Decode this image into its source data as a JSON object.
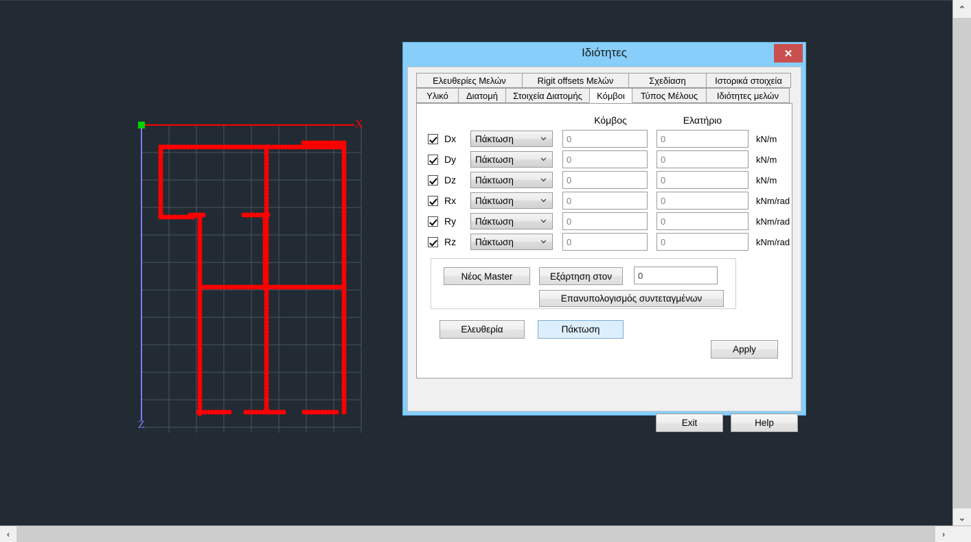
{
  "app": {
    "canvas": {
      "axis_x_label": "X",
      "axis_z_label": "Z",
      "bg_color": "#222b33",
      "grid_color": "#4a545e",
      "node_color": "#ff0000",
      "axis_x_color": "#ff0000",
      "axis_z_color": "#7b7bff",
      "origin_color": "#00d400"
    },
    "scrollbars": {
      "v_up_icon": "chevron-up-icon",
      "v_down_icon": "chevron-down-icon",
      "h_left_icon": "chevron-left-icon",
      "h_right_icon": "chevron-right-icon",
      "v_up_glyph": "⌃",
      "v_down_glyph": "⌄",
      "h_left_glyph": "‹",
      "h_right_glyph": "›"
    }
  },
  "dialog": {
    "title": "Ιδιότητες",
    "close_label": "✕",
    "close_icon": "close-icon",
    "title_bar_color": "#87cefa",
    "close_button_color": "#c9504e",
    "tabs_row1": [
      {
        "label": "Ελευθερίες Μελών",
        "active": false
      },
      {
        "label": "Rigit offsets Μελών",
        "active": false
      },
      {
        "label": "Σχεδίαση",
        "active": false
      },
      {
        "label": "Ιστορικά στοιχεία",
        "active": false
      }
    ],
    "tabs_row2": [
      {
        "label": "Υλικό",
        "active": false
      },
      {
        "label": "Διατομή",
        "active": false
      },
      {
        "label": "Στοιχεία Διατομής",
        "active": false
      },
      {
        "label": "Κόμβοι",
        "active": true
      },
      {
        "label": "Τύπος Μέλους",
        "active": false
      },
      {
        "label": "Ιδιότητες μελών",
        "active": false
      }
    ],
    "panel": {
      "col_header_node": "Κόμβος",
      "col_header_spring": "Ελατήριο",
      "dof_rows": [
        {
          "label": "Dx",
          "checked": true,
          "condition": "Πάκτωση",
          "node_value": "0",
          "spring_value": "0",
          "unit": "kN/m"
        },
        {
          "label": "Dy",
          "checked": true,
          "condition": "Πάκτωση",
          "node_value": "0",
          "spring_value": "0",
          "unit": "kN/m"
        },
        {
          "label": "Dz",
          "checked": true,
          "condition": "Πάκτωση",
          "node_value": "0",
          "spring_value": "0",
          "unit": "kN/m"
        },
        {
          "label": "Rx",
          "checked": true,
          "condition": "Πάκτωση",
          "node_value": "0",
          "spring_value": "0",
          "unit": "kNm/rad"
        },
        {
          "label": "Ry",
          "checked": true,
          "condition": "Πάκτωση",
          "node_value": "0",
          "spring_value": "0",
          "unit": "kNm/rad"
        },
        {
          "label": "Rz",
          "checked": true,
          "condition": "Πάκτωση",
          "node_value": "0",
          "spring_value": "0",
          "unit": "kNm/rad"
        }
      ],
      "master_group": {
        "new_master_label": "Νέος Master",
        "dependency_label": "Εξάρτηση στον",
        "dependency_value": "0",
        "recalc_label": "Επανυπολογισμός συντεταγμένων"
      },
      "free_label": "Ελευθερία",
      "fix_label": "Πάκτωση",
      "apply_label": "Apply"
    },
    "exit_label": "Exit",
    "help_label": "Help"
  }
}
